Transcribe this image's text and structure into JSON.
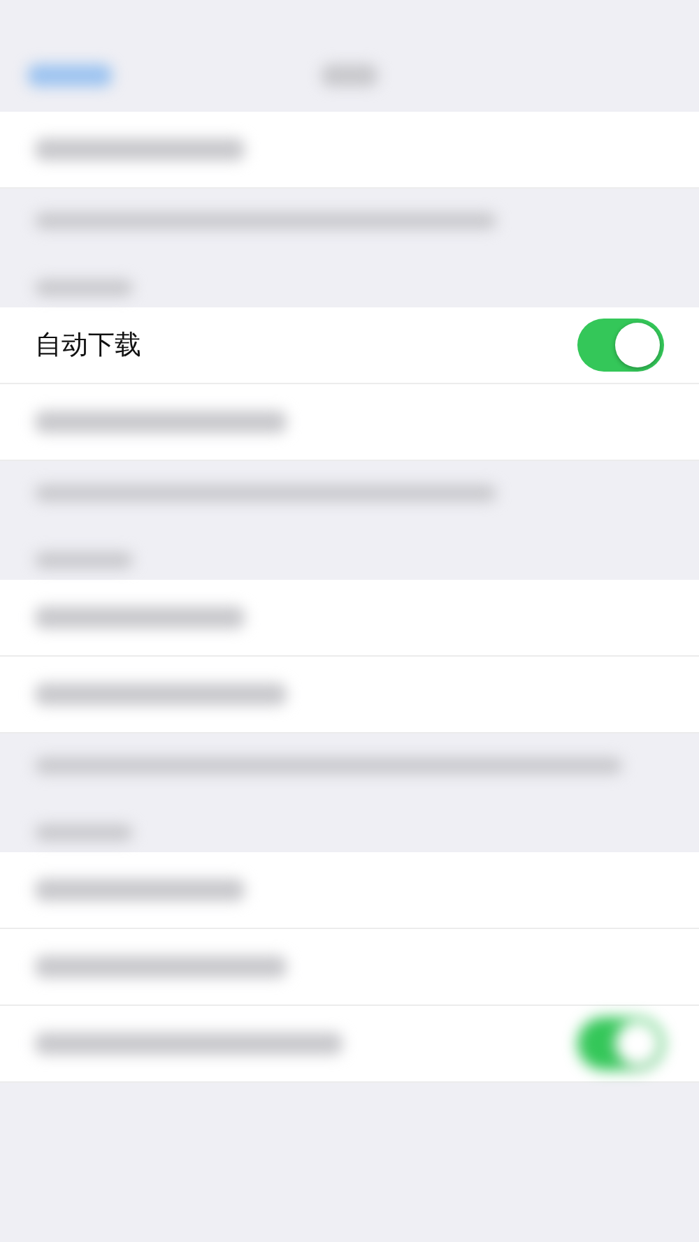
{
  "sections": [
    {
      "rows": [
        {
          "kind": "blur"
        }
      ]
    },
    {
      "rows": [
        {
          "kind": "toggle",
          "label": "自动下载",
          "on": true
        },
        {
          "kind": "blur"
        }
      ]
    },
    {
      "rows": [
        {
          "kind": "blur"
        },
        {
          "kind": "blur"
        }
      ]
    },
    {
      "rows": [
        {
          "kind": "blur"
        },
        {
          "kind": "blur"
        },
        {
          "kind": "blur-toggle",
          "on": true
        }
      ]
    }
  ]
}
